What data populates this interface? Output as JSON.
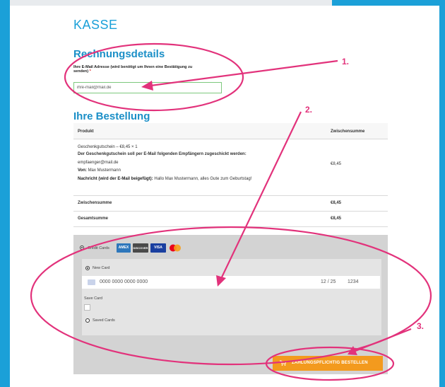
{
  "page": {
    "title": "KASSE"
  },
  "billing": {
    "heading": "Rechnungsdetails",
    "email_label_line1": "Ihre E-Mail Adresse (wird benötigt um Ihnen eine Bestätigung zu",
    "email_label_line2": "senden)",
    "required_mark": "*",
    "email_value": "ihre-mail@mail.de"
  },
  "order": {
    "heading": "Ihre Bestellung",
    "col_product": "Produkt",
    "col_subtotal": "Zwischensumme",
    "item_name": "Geschenkgutschein – €8,45  × 1",
    "item_note_label": "Der Geschenkgutschein soll per E-Mail folgenden Empfängern zugeschickt werden:",
    "item_recipient": "empfaenger@mail.de",
    "from_label": "Von:",
    "from_value": "Max Mustermann",
    "message_label": "Nachricht (wird der E-Mail beigefügt):",
    "message_value": "Hallo Max Mustermann, alles Gute zum Geburtstag!",
    "item_price": "€8,45",
    "subtotal_label": "Zwischensumme",
    "subtotal_value": "€8,45",
    "total_label": "Gesamtsumme",
    "total_value": "€8,45"
  },
  "payment": {
    "method_label": "Credit Cards",
    "card_logos": [
      "AMEX",
      "DISCOVER",
      "VISA",
      "mastercard"
    ],
    "new_card_label": "New Card",
    "card_number_placeholder": "0000 0000 0000 0000",
    "expiry": "12 / 25",
    "cvc": "1234",
    "save_card_label": "Save Card",
    "saved_cards_label": "Saved Cards",
    "place_order_label": "ZAHLUNGSPFLICHTIG BESTELLEN"
  },
  "annotations": {
    "step1": "1.",
    "step2": "2.",
    "step3": "3.",
    "color": "#e2327b"
  },
  "colors": {
    "accent": "#1ba0d8",
    "button": "#f39a1e",
    "annotation": "#e2327b"
  }
}
